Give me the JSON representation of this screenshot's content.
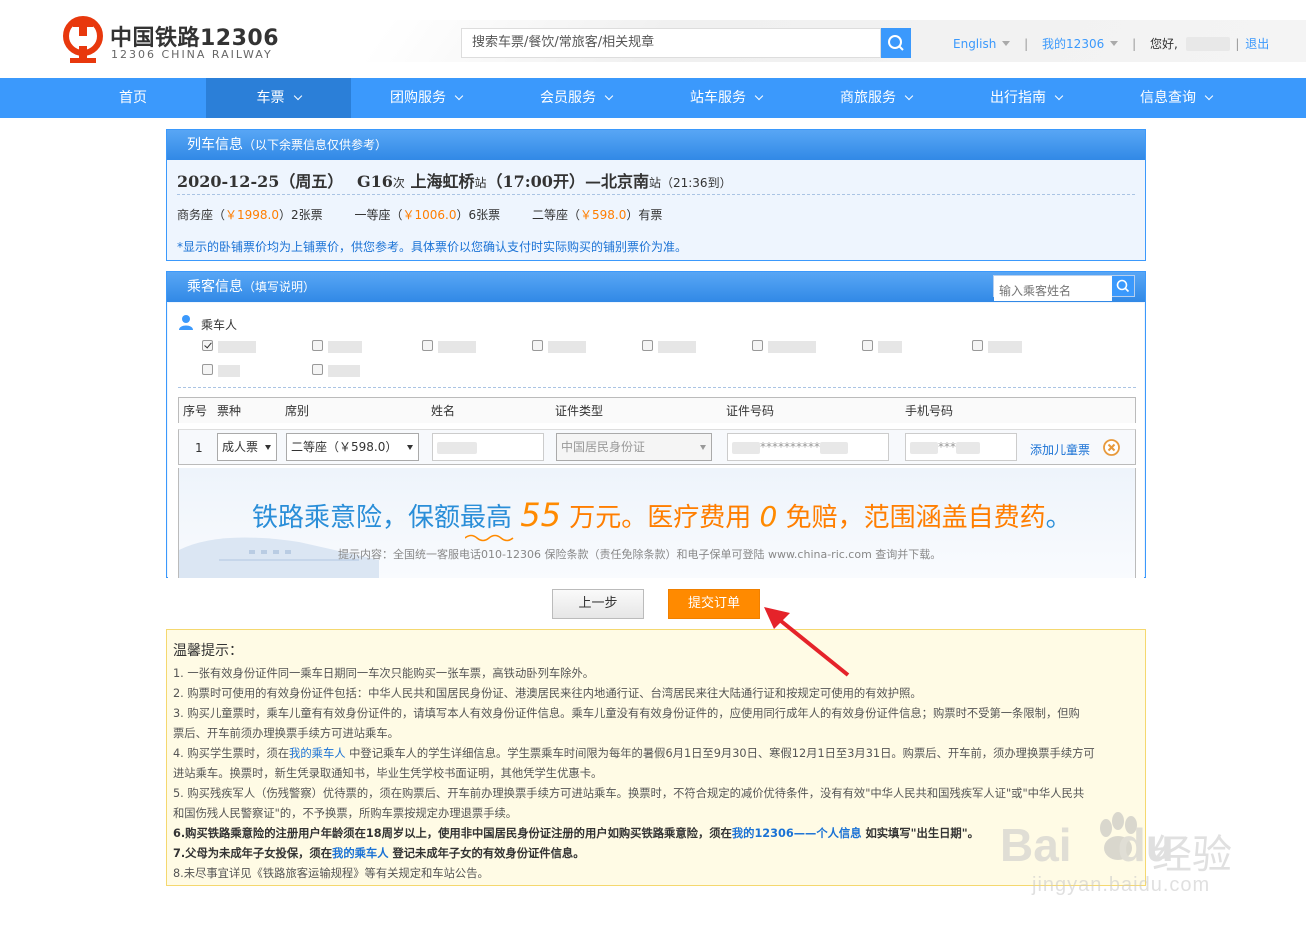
{
  "header": {
    "logo_cn": "中国铁路12306",
    "logo_en": "12306 CHINA RAILWAY",
    "search_placeholder": "搜索车票/餐饮/常旅客/相关规章",
    "lang": "English",
    "my12306": "我的12306",
    "greeting": "您好,",
    "logout": "退出"
  },
  "nav": [
    {
      "label": "首页"
    },
    {
      "label": "车票"
    },
    {
      "label": "团购服务"
    },
    {
      "label": "会员服务"
    },
    {
      "label": "站车服务"
    },
    {
      "label": "商旅服务"
    },
    {
      "label": "出行指南"
    },
    {
      "label": "信息查询"
    }
  ],
  "train_panel": {
    "title": "列车信息",
    "subtitle": "（以下余票信息仅供参考）",
    "date": "2020-12-25（周五）",
    "train_no": "G16",
    "ci": "次",
    "from": "上海虹桥",
    "zhan": "站",
    "depart": "（17:00开）",
    "dash": "—",
    "to": "北京南",
    "arrive": "（21:36到）",
    "seats": [
      {
        "name": "商务座（",
        "price": "￥1998.0",
        "close": "）",
        "left": "2张票"
      },
      {
        "name": "一等座（",
        "price": "￥1006.0",
        "close": "）",
        "left": "6张票"
      },
      {
        "name": "二等座（",
        "price": "￥598.0",
        "close": "）",
        "left": "有票"
      }
    ],
    "note": "*显示的卧铺票价均为上铺票价，供您参考。具体票价以您确认支付时实际购买的铺别票价为准。"
  },
  "passenger_panel": {
    "title": "乘客信息",
    "subtitle": "（填写说明）",
    "search_placeholder": "输入乘客姓名",
    "label": "乘车人",
    "columns": [
      "序号",
      "票种",
      "席别",
      "姓名",
      "证件类型",
      "证件号码",
      "手机号码"
    ],
    "row": {
      "index": "1",
      "ticket_type": "成人票",
      "seat_class": "二等座（￥598.0）",
      "id_type": "中国居民身份证",
      "id_number": "**********",
      "phone": "***",
      "add_child": "添加儿童票"
    }
  },
  "ad": {
    "part1": "铁路乘意险，保额最高 ",
    "num55": "55",
    "part2": " 万元。医疗费用 ",
    "num0": "0",
    "part3": " 免赔，范围涵盖",
    "part4": "自费药",
    "part5": "。",
    "tip": "提示内容：全国统一客服电话010-12306 保险条款（责任免除条款）和电子保单可登陆 www.china-ric.com 查询并下载。"
  },
  "buttons": {
    "prev": "上一步",
    "submit": "提交订单"
  },
  "tips": {
    "title": "温馨提示：",
    "t1": "1. 一张有效身份证件同一乘车日期同一车次只能购买一张车票，高铁动卧列车除外。",
    "t2": "2. 购票时可使用的有效身份证件包括：中华人民共和国居民身份证、港澳居民来往内地通行证、台湾居民来往大陆通行证和按规定可使用的有效护照。",
    "t3a": "3. 购买儿童票时，乘车儿童有有效身份证件的，请填写本人有效身份证件信息。乘车儿童没有有效身份证件的，应使用同行成年人的有效身份证件信息；购票时不受第一条限制，但购",
    "t3b": "票后、开车前须办理换票手续方可进站乘车。",
    "t4a_pre": "4. 购买学生票时，须在",
    "t4a_link": "我的乘车人",
    "t4a_post": " 中登记乘车人的学生详细信息。学生票乘车时间限为每年的暑假6月1日至9月30日、寒假12月1日至3月31日。购票后、开车前，须办理换票手续方可",
    "t4b": "进站乘车。换票时，新生凭录取通知书，毕业生凭学校书面证明，其他凭学生优惠卡。",
    "t5a": "5. 购买残疾军人（伤残警察）优待票的，须在购票后、开车前办理换票手续方可进站乘车。换票时，不符合规定的减价优待条件，没有有效\"中华人民共和国残疾军人证\"或\"中华人民共",
    "t5b": "和国伤残人民警察证\"的，不予换票，所购车票按规定办理退票手续。",
    "t6_pre": "6.购买铁路乘意险的注册用户年龄须在18周岁以上，使用非中国居民身份证注册的用户如购买铁路乘意险，须在",
    "t6_link": "我的12306——个人信息",
    "t6_post": " 如实填写\"出生日期\"。",
    "t7_pre": "7.父母为未成年子女投保，须在",
    "t7_link": "我的乘车人",
    "t7_post": " 登记未成年子女的有效身份证件信息。",
    "t8": "8.未尽事宜详见《铁路旅客运输规程》等有关规定和车站公告。"
  },
  "watermark": {
    "brand": "Bai",
    "brand2": "du",
    "cn": "经验",
    "url": "jingyan.baidu.com"
  },
  "colors": {
    "primary": "#3b99fc",
    "nav_active": "#2b7fd8",
    "accent": "#ff8a00",
    "logo_red": "#e8380d"
  }
}
